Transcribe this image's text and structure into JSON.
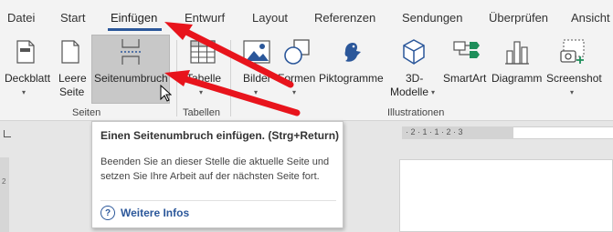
{
  "tabs": [
    "Datei",
    "Start",
    "Einfügen",
    "Entwurf",
    "Layout",
    "Referenzen",
    "Sendungen",
    "Überprüfen",
    "Ansicht"
  ],
  "ribbon": {
    "deckblatt": "Deckblatt",
    "leere_seite_1": "Leere",
    "leere_seite_2": "Seite",
    "seitenumbruch": "Seitenumbruch",
    "tabelle": "Tabelle",
    "bilder": "Bilder",
    "formen": "Formen",
    "piktogramme": "Piktogramme",
    "modelle_1": "3D-",
    "modelle_2": "Modelle",
    "smartart": "SmartArt",
    "diagramm": "Diagramm",
    "screenshot": "Screenshot",
    "groups": {
      "seiten": "Seiten",
      "tabellen": "Tabellen",
      "illustrationen": "Illustrationen"
    }
  },
  "tooltip": {
    "title": "Einen Seitenumbruch einfügen. (Strg+Return)",
    "body": "Beenden Sie an dieser Stelle die aktuelle Seite und setzen Sie Ihre Arbeit auf der nächsten Seite fort.",
    "link": "Weitere Infos"
  },
  "rulers": {
    "top": "· 2 · 1 · 1 · 2 · 3",
    "left": "2"
  },
  "colors": {
    "accent": "#2b579a",
    "arrow": "#e8141c",
    "ribbon_bg": "#f3f3f3",
    "hover_bg": "#c8c8c8"
  },
  "icons": [
    "cover-page-icon",
    "blank-page-icon",
    "page-break-icon",
    "table-icon",
    "pictures-icon",
    "shapes-icon",
    "icons-icon",
    "3d-models-icon",
    "smartart-icon",
    "chart-icon",
    "screenshot-icon",
    "help-icon",
    "cursor-icon"
  ]
}
